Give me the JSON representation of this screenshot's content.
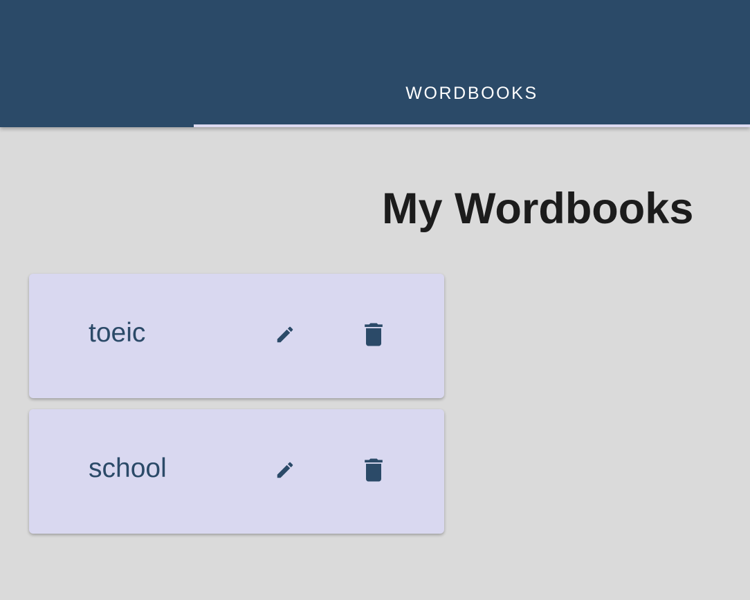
{
  "header": {
    "tabs": [
      {
        "label": "WORDBOOKS",
        "active": true
      }
    ]
  },
  "main": {
    "title": "My Wordbooks",
    "wordbooks": [
      {
        "name": "toeic",
        "actions": [
          "edit-icon",
          "delete-icon"
        ]
      },
      {
        "name": "school",
        "actions": [
          "edit-icon",
          "delete-icon"
        ]
      }
    ]
  },
  "colors": {
    "primary": "#2b4a68",
    "card_background": "#d9d8f0",
    "page_background": "#dadada",
    "tab_indicator": "#dcdaf0"
  }
}
